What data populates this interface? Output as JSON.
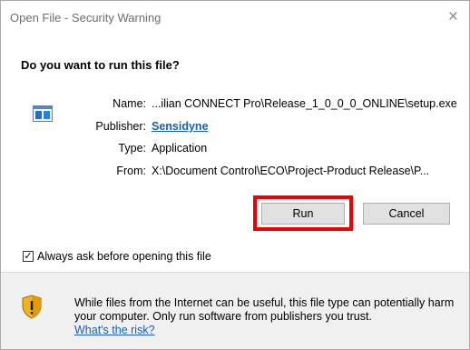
{
  "window": {
    "title": "Open File - Security Warning",
    "close_glyph": "×"
  },
  "question": "Do you want to run this file?",
  "file_icon": "application-window-icon",
  "details": {
    "name_label": "Name:",
    "name_value": "...ilian CONNECT Pro\\Release_1_0_0_0_ONLINE\\setup.exe",
    "publisher_label": "Publisher:",
    "publisher_value": "Sensidyne",
    "type_label": "Type:",
    "type_value": "Application",
    "from_label": "From:",
    "from_value": "X:\\Document Control\\ECO\\Project-Product Release\\P..."
  },
  "buttons": {
    "run": "Run",
    "cancel": "Cancel"
  },
  "highlight_color": "#ee0000",
  "checkbox": {
    "label": "Always ask before opening this file",
    "checked": true,
    "mark": "✓"
  },
  "warning": {
    "icon": "shield-warning-icon",
    "text": "While files from the Internet can be useful, this file type can potentially harm your computer. Only run software from publishers you trust.",
    "link": "What's the risk?"
  }
}
